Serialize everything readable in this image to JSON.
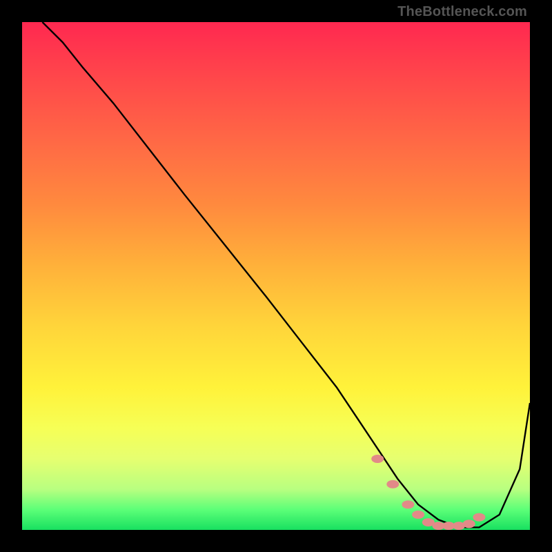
{
  "watermark": "TheBottleneck.com",
  "chart_data": {
    "type": "line",
    "title": "",
    "xlabel": "",
    "ylabel": "",
    "xlim": [
      0,
      100
    ],
    "ylim": [
      0,
      100
    ],
    "series": [
      {
        "name": "bottleneck-curve",
        "x": [
          4,
          8,
          12,
          18,
          25,
          32,
          40,
          48,
          55,
          62,
          66,
          70,
          74,
          78,
          82,
          86,
          90,
          94,
          98,
          100
        ],
        "y": [
          100,
          96,
          91,
          84,
          75,
          66,
          56,
          46,
          37,
          28,
          22,
          16,
          10,
          5,
          2,
          0.5,
          0.5,
          3,
          12,
          25
        ]
      }
    ],
    "markers": {
      "name": "highlight-points",
      "x": [
        70,
        73,
        76,
        78,
        80,
        82,
        84,
        86,
        88,
        90
      ],
      "y": [
        14,
        9,
        5,
        3,
        1.5,
        0.8,
        0.8,
        0.8,
        1.2,
        2.5
      ]
    },
    "colors": {
      "curve": "#000000",
      "marker": "#e28a88"
    }
  }
}
